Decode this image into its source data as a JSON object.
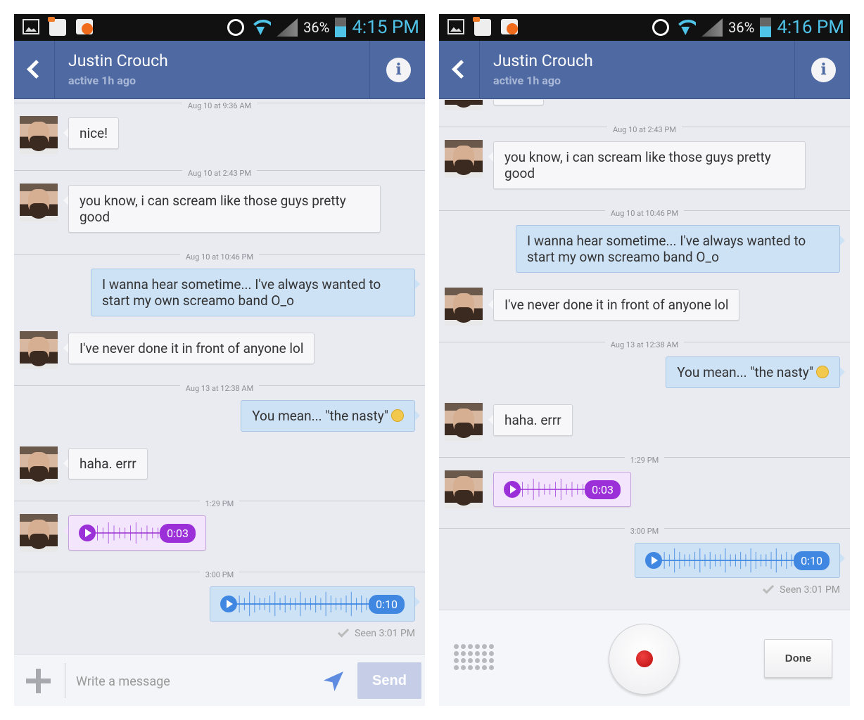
{
  "screens": [
    {
      "status": {
        "battery": "36%",
        "time": "4:15 PM"
      }
    },
    {
      "status": {
        "battery": "36%",
        "time": "4:16 PM"
      }
    }
  ],
  "header": {
    "name": "Justin Crouch",
    "status": "active 1h ago"
  },
  "conversation": {
    "messages": [
      {
        "type": "divider",
        "text": "Aug 10 at 9:36 AM"
      },
      {
        "type": "received",
        "text": "nice!"
      },
      {
        "type": "divider",
        "text": "Aug 10 at 2:43 PM"
      },
      {
        "type": "received",
        "text": "you know, i can scream like those guys pretty good"
      },
      {
        "type": "divider",
        "text": "Aug 10 at 10:46 PM"
      },
      {
        "type": "sent",
        "text": "I wanna hear sometime... I've always wanted to start my own screamo band O_o"
      },
      {
        "type": "received",
        "text": "I've never done it in front of anyone lol"
      },
      {
        "type": "divider",
        "text": "Aug 13 at 12:38 AM"
      },
      {
        "type": "sent",
        "text": "You mean... \"the nasty\"",
        "emoji": "weary-face-emoji"
      },
      {
        "type": "received",
        "text": "haha. errr"
      },
      {
        "type": "divider",
        "text": "1:29 PM"
      },
      {
        "type": "received-audio",
        "duration": "0:03",
        "color": "#9b30d9"
      },
      {
        "type": "divider",
        "text": "3:00 PM"
      },
      {
        "type": "sent-audio",
        "duration": "0:10",
        "color": "#3f87e0"
      }
    ],
    "seen": "Seen 3:01 PM"
  },
  "composer": {
    "placeholder": "Write a message",
    "send_label": "Send"
  },
  "recorder": {
    "done_label": "Done"
  },
  "colors": {
    "header": "#4f6aa3",
    "sent_bubble": "#cee2f6",
    "audio_received": "#9b30d9",
    "audio_sent": "#3f87e0",
    "status_time": "#4fc3e8"
  }
}
